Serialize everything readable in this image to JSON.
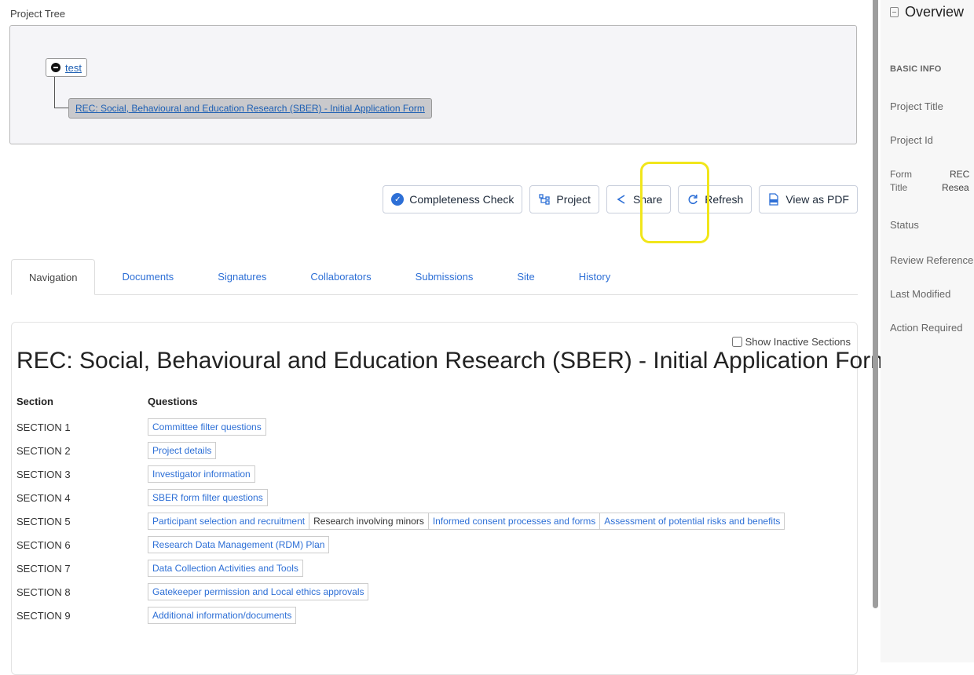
{
  "project_tree": {
    "label": "Project Tree",
    "root_node": "test",
    "child_node": "REC: Social, Behavioural and Education Research (SBER) - Initial Application Form"
  },
  "toolbar": {
    "completeness_check": "Completeness Check",
    "project": "Project",
    "share": "Share",
    "refresh": "Refresh",
    "view_pdf": "View as PDF"
  },
  "tabs": [
    "Navigation",
    "Documents",
    "Signatures",
    "Collaborators",
    "Submissions",
    "Site",
    "History"
  ],
  "form": {
    "show_inactive_label": "Show Inactive Sections",
    "show_inactive_checked": false,
    "title": "REC: Social, Behavioural and Education Research (SBER) - Initial Application Form",
    "col_section": "Section",
    "col_questions": "Questions",
    "sections": [
      {
        "name": "SECTION 1",
        "questions": [
          {
            "label": "Committee filter questions",
            "active": true
          }
        ]
      },
      {
        "name": "SECTION 2",
        "questions": [
          {
            "label": "Project details",
            "active": true
          }
        ]
      },
      {
        "name": "SECTION 3",
        "questions": [
          {
            "label": "Investigator information",
            "active": true
          }
        ]
      },
      {
        "name": "SECTION 4",
        "questions": [
          {
            "label": "SBER form filter questions",
            "active": true
          }
        ]
      },
      {
        "name": "SECTION 5",
        "questions": [
          {
            "label": "Participant selection and recruitment",
            "active": true
          },
          {
            "label": "Research involving minors",
            "active": false
          },
          {
            "label": "Informed consent processes and forms",
            "active": true
          },
          {
            "label": "Assessment of potential risks and benefits",
            "active": true
          }
        ]
      },
      {
        "name": "SECTION 6",
        "questions": [
          {
            "label": "Research Data Management (RDM) Plan",
            "active": true
          }
        ]
      },
      {
        "name": "SECTION 7",
        "questions": [
          {
            "label": "Data Collection Activities and Tools",
            "active": true
          }
        ]
      },
      {
        "name": "SECTION 8",
        "questions": [
          {
            "label": "Gatekeeper permission and Local ethics approvals",
            "active": true
          }
        ]
      },
      {
        "name": "SECTION 9",
        "questions": [
          {
            "label": "Additional information/documents",
            "active": true
          }
        ]
      }
    ]
  },
  "overview": {
    "title": "Overview",
    "section": "BASIC INFO",
    "project_title": "Project Title",
    "project_id": "Project Id",
    "form_title_label_1": "Form",
    "form_title_label_2": "Title",
    "form_title_value_1": "REC",
    "form_title_value_2": "Resea",
    "status": "Status",
    "review_reference": "Review Reference",
    "last_modified": "Last Modified",
    "action_required": "Action Required"
  },
  "colors": {
    "link": "#2d6fd6",
    "highlight": "#f1e61b"
  }
}
